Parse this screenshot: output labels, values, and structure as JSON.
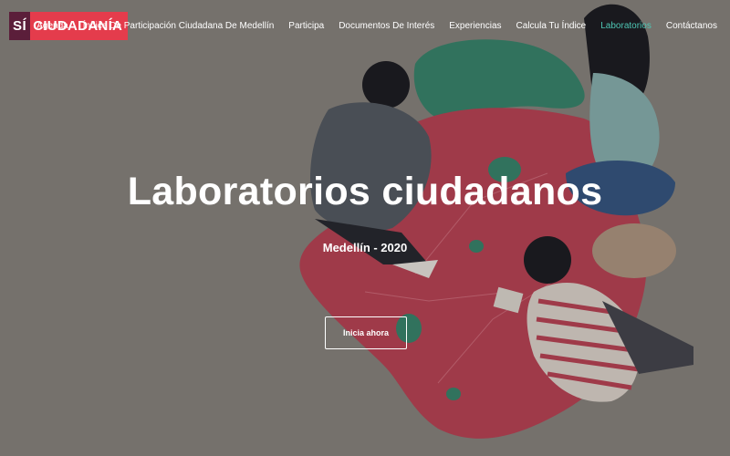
{
  "brand": {
    "si": "SÍ",
    "ciudadania": "CIUDADANÍA"
  },
  "nav": {
    "items": [
      {
        "label": "Agenda"
      },
      {
        "label": "Índice De Participación Ciudadana De Medellín"
      },
      {
        "label": "Participa"
      },
      {
        "label": "Documentos De Interés"
      },
      {
        "label": "Experiencias"
      },
      {
        "label": "Calcula Tu Índice"
      },
      {
        "label": "Laboratorios",
        "active": true
      },
      {
        "label": "Contáctanos"
      }
    ]
  },
  "hero": {
    "title": "Laboratorios ciudadanos",
    "subtitle": "Medellín - 2020",
    "cta_label": "Inicia ahora"
  },
  "colors": {
    "background": "#8f8a84",
    "map_red": "#c2475a",
    "map_green": "#3c8c72",
    "active_link": "#4ec6b4",
    "logo_dark": "#5b1e3a",
    "logo_red": "#e43c4c"
  }
}
